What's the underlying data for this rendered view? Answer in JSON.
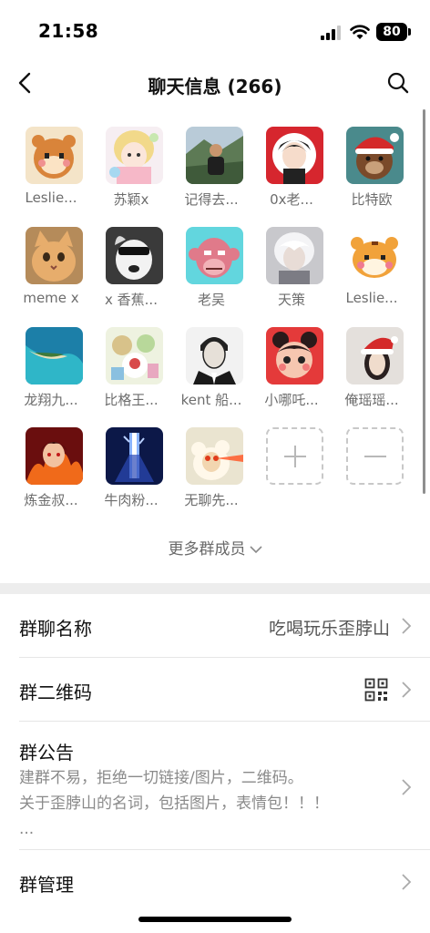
{
  "status": {
    "time": "21:58",
    "battery": "80"
  },
  "nav": {
    "title": "聊天信息 (266)"
  },
  "members": [
    {
      "name": "Leslie...",
      "avatar": "hamster-pixel-avatar"
    },
    {
      "name": "苏颖x",
      "avatar": "anime-girl-avatar"
    },
    {
      "name": "记得去...",
      "avatar": "man-mountain-avatar"
    },
    {
      "name": "0x老...",
      "avatar": "anime-boy-avatar"
    },
    {
      "name": "比特欧",
      "avatar": "santa-bear-avatar"
    },
    {
      "name": "meme x",
      "avatar": "cat-avatar"
    },
    {
      "name": "x 香蕉...",
      "avatar": "sunglasses-dog-avatar"
    },
    {
      "name": "老吴",
      "avatar": "pink-ape-avatar"
    },
    {
      "name": "天策",
      "avatar": "white-hair-avatar"
    },
    {
      "name": "Leslie...",
      "avatar": "tiger-pixel-avatar"
    },
    {
      "name": "龙翔九...",
      "avatar": "island-avatar"
    },
    {
      "name": "比格王...",
      "avatar": "cartoon-collage-avatar"
    },
    {
      "name": "kent 船...",
      "avatar": "suit-man-avatar"
    },
    {
      "name": "小哪吒...",
      "avatar": "nezha-avatar"
    },
    {
      "name": "俺瑶瑶...",
      "avatar": "santa-hat-girl-avatar"
    },
    {
      "name": "炼金叔...",
      "avatar": "fire-anime-avatar"
    },
    {
      "name": "牛肉粉...",
      "avatar": "blue-neon-avatar"
    },
    {
      "name": "无聊先...",
      "avatar": "laser-sheep-avatar"
    }
  ],
  "more_members": "更多群成员",
  "rows": {
    "group_name": {
      "label": "群聊名称",
      "value": "吃喝玩乐歪脖山"
    },
    "qr_code": {
      "label": "群二维码"
    },
    "notice": {
      "label": "群公告",
      "line1": "建群不易，拒绝一切链接/图片，二维码。",
      "line2": "关于歪脖山的名词，包括图片，表情包！！！",
      "line3": "..."
    },
    "manage": {
      "label": "群管理"
    }
  }
}
